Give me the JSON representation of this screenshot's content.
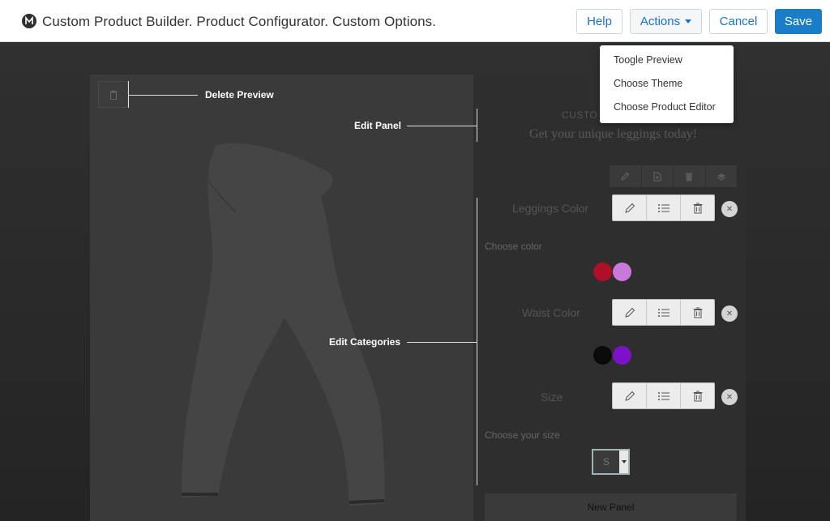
{
  "header": {
    "title": "Custom Product Builder. Product Configurator. Custom Options.",
    "help_label": "Help",
    "actions_label": "Actions",
    "cancel_label": "Cancel",
    "save_label": "Save"
  },
  "actions_menu": {
    "items": [
      "Toogle Preview",
      "Choose Theme",
      "Choose Product Editor"
    ]
  },
  "annotations": {
    "delete_preview": "Delete Preview",
    "edit_panel": "Edit Panel",
    "edit_categories": "Edit Categories"
  },
  "panel": {
    "top_title": "CUSTO",
    "subtitle": "Get your unique leggings today!",
    "categories": [
      {
        "label": "Leggings Color",
        "prompt": "Choose color",
        "swatches": [
          "#b00f2a",
          "#c879d9"
        ]
      },
      {
        "label": "Waist Color",
        "prompt": "",
        "swatches": [
          "#0a0a0a",
          "#7b12c9"
        ]
      },
      {
        "label": "Size",
        "prompt": "Choose your size",
        "selected": "S"
      }
    ],
    "new_panel_label": "New Panel"
  },
  "icons": [
    "logo-icon",
    "trash-icon",
    "pencil-icon",
    "list-icon",
    "close-icon",
    "layers-icon",
    "file-icon",
    "caret-down-icon"
  ],
  "colors": {
    "accent": "#1a7dc9",
    "dark_bg": "#2a2a2a"
  }
}
